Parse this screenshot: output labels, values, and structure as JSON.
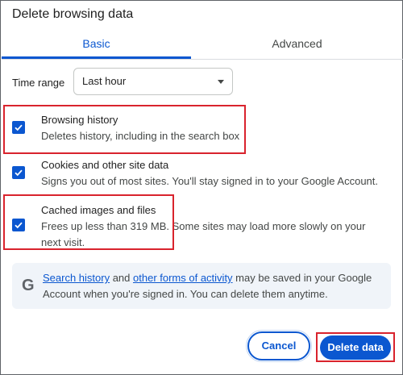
{
  "dialog": {
    "title": "Delete browsing data"
  },
  "tabs": [
    {
      "label": "Basic",
      "selected": true
    },
    {
      "label": "Advanced",
      "selected": false
    }
  ],
  "time_range": {
    "label": "Time range",
    "value": "Last hour"
  },
  "options": [
    {
      "title": "Browsing history",
      "description": "Deletes history, including in the search box",
      "checked": true
    },
    {
      "title": "Cookies and other site data",
      "description": "Signs you out of most sites. You'll stay signed in to your Google Account.",
      "checked": true
    },
    {
      "title": "Cached images and files",
      "description": "Frees up less than 319 MB. Some sites may load more slowly on your next visit.",
      "checked": true
    }
  ],
  "info": {
    "icon": "google-g-icon",
    "link1": "Search history",
    "text1": " and ",
    "link2": "other forms of activity",
    "text2": " may be saved in your Google Account when you're signed in. You can delete them anytime."
  },
  "buttons": {
    "cancel": "Cancel",
    "delete": "Delete data"
  },
  "colors": {
    "accent": "#0b57d0",
    "highlight": "#d9232d",
    "info_bg": "#f0f4f9"
  }
}
